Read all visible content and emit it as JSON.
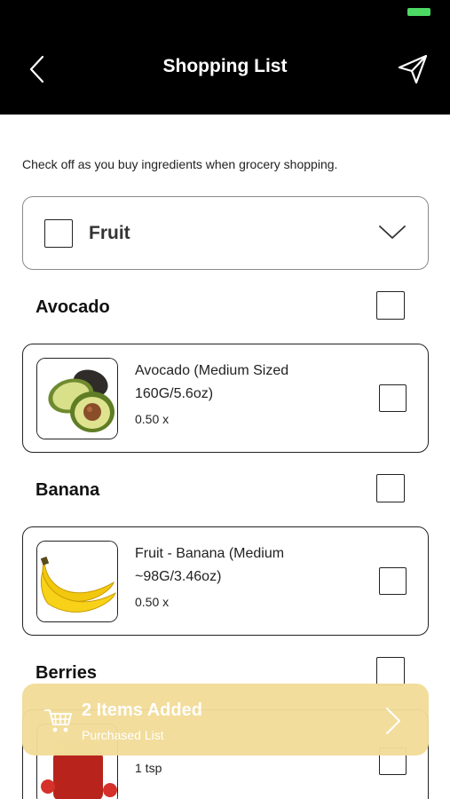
{
  "header": {
    "title": "Shopping List"
  },
  "instruction": "Check off as you buy ingredients when grocery shopping.",
  "category": {
    "label": "Fruit"
  },
  "groups": [
    {
      "name": "Avocado",
      "item": {
        "name": "Avocado (Medium Sized 160G/5.6oz)",
        "qty": "0.50 x"
      }
    },
    {
      "name": "Banana",
      "item": {
        "name": "Fruit - Banana (Medium ~98G/3.46oz)",
        "qty": "0.50 x"
      }
    },
    {
      "name": "Berries",
      "item": {
        "qty": "1 tsp"
      }
    }
  ],
  "floating_bar": {
    "title": "2 Items Added",
    "subtitle": "Purchased List"
  },
  "colors": {
    "header_bg": "#000000",
    "battery": "#4cd964",
    "floating_bg": "#f2dc98"
  },
  "icons": {
    "back": "chevron-left-icon",
    "send": "paper-plane-icon",
    "collapse": "chevron-down-icon",
    "cart": "cart-icon",
    "forward": "chevron-right-icon"
  }
}
